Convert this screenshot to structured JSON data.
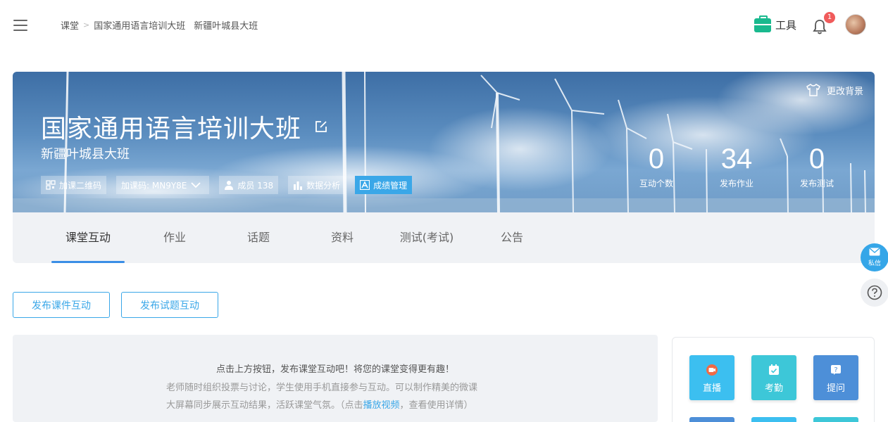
{
  "breadcrumb": {
    "home": "课堂",
    "separator": ">",
    "course": "国家通用语言培训大班",
    "class": "新疆叶城县大班"
  },
  "header": {
    "tools_label": "工具",
    "notification_count": "1"
  },
  "banner": {
    "change_bg_label": "更改背景",
    "course_title": "国家通用语言培训大班",
    "class_name": "新疆叶城县大班",
    "chips": {
      "qr_label": "加课二维码",
      "code_label": "加课码: MN9Y8E",
      "members_label": "成员 138",
      "analytics_label": "数据分析",
      "grades_label": "成绩管理"
    },
    "stats": [
      {
        "value": "0",
        "label": "互动个数"
      },
      {
        "value": "34",
        "label": "发布作业"
      },
      {
        "value": "0",
        "label": "发布测试"
      }
    ]
  },
  "tabs": [
    {
      "label": "课堂互动",
      "active": true
    },
    {
      "label": "作业"
    },
    {
      "label": "话题"
    },
    {
      "label": "资料"
    },
    {
      "label": "测试(考试)"
    },
    {
      "label": "公告"
    }
  ],
  "floating": {
    "message_label": "私信"
  },
  "actions": {
    "publish_courseware": "发布课件互动",
    "publish_question": "发布试题互动"
  },
  "empty_state": {
    "title": "点击上方按钮，发布课堂互动吧！将您的课堂变得更有趣！",
    "desc_line1": "老师随时组织投票与讨论，学生使用手机直接参与互动。可以制作精美的微课",
    "desc_line2_prefix": "大屏幕同步展示互动结果，活跃课堂气氛。（点击",
    "desc_link": "播放视频",
    "desc_line2_suffix": "，查看使用详情）"
  },
  "side_tools": [
    {
      "label": "直播",
      "color": "#3cbff0",
      "icon": "live-icon"
    },
    {
      "label": "考勤",
      "color": "#3dc7d8",
      "icon": "attendance-icon"
    },
    {
      "label": "提问",
      "color": "#4d8fd8",
      "icon": "question-icon"
    }
  ],
  "colors": {
    "accent": "#3aa7e8",
    "tools_green": "#19b98e",
    "badge_red": "#f05b5b"
  }
}
